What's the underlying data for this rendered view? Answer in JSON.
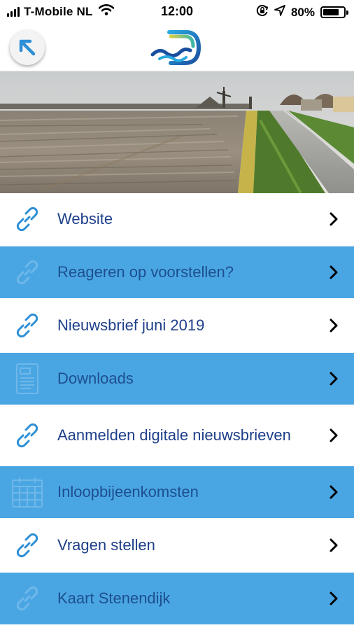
{
  "status_bar": {
    "carrier": "T-Mobile NL",
    "time": "12:00",
    "battery_percent": "80%",
    "battery_level": 0.8,
    "icons": [
      "signal-icon",
      "wifi-icon",
      "screen-lock-icon",
      "location-icon",
      "battery-icon"
    ]
  },
  "header": {
    "back_icon": "arrow-up-left-icon",
    "logo": "wave-logo"
  },
  "menu": {
    "items": [
      {
        "label": "Website",
        "icon": "link-icon",
        "style": "white"
      },
      {
        "label": "Reageren op voorstellen?",
        "icon": "link-icon",
        "style": "blue"
      },
      {
        "label": "Nieuwsbrief juni 2019",
        "icon": "link-icon",
        "style": "white"
      },
      {
        "label": "Downloads",
        "icon": "document-icon",
        "style": "blue"
      },
      {
        "label": "Aanmelden digitale nieuwsbrieven",
        "icon": "link-icon",
        "style": "white"
      },
      {
        "label": "Inloopbijeenkomsten",
        "icon": "calendar-icon",
        "style": "blue"
      },
      {
        "label": "Vragen stellen",
        "icon": "link-icon",
        "style": "white"
      },
      {
        "label": "Kaart Stenendijk",
        "icon": "link-icon",
        "style": "blue"
      }
    ]
  },
  "colors": {
    "accent_blue": "#4aa6e3",
    "label_dark_blue": "#1e3f8a",
    "icon_blue": "#2d8fd6"
  }
}
